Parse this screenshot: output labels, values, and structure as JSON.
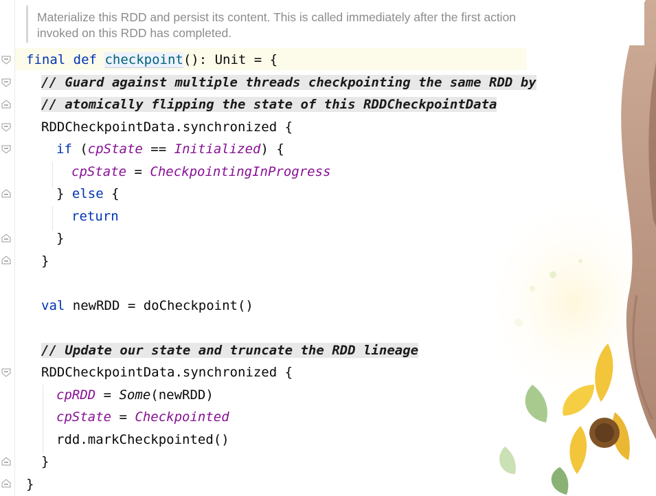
{
  "doc_comment": {
    "line1": "Materialize this RDD and persist its content. This is called immediately after the first action",
    "line2": "invoked on this RDD has completed."
  },
  "code": {
    "l1_final": "final",
    "l1_def": "def",
    "l1_name": "checkpoint",
    "l1_rest": "(): Unit = {",
    "l2_comment": "// Guard against multiple threads checkpointing the same RDD by",
    "l3_comment": "// atomically flipping the state of this RDDCheckpointData",
    "l4_sync": "RDDCheckpointData.synchronized {",
    "l5_if": "if",
    "l5_open": " (",
    "l5_cp": "cpState",
    "l5_eq": " == ",
    "l5_init": "Initialized",
    "l5_close": ") {",
    "l6_cp": "cpState",
    "l6_eq": " = ",
    "l6_val": "CheckpointingInProgress",
    "l7_close": "} ",
    "l7_else": "else",
    "l7_open": " {",
    "l8_return": "return",
    "l9_brace": "}",
    "l10_brace": "}",
    "l11_val": "val",
    "l11_rest": " newRDD = doCheckpoint()",
    "l12_comment": "// Update our state and truncate the RDD lineage",
    "l13_sync": "RDDCheckpointData.synchronized {",
    "l14_cprdd": "cpRDD",
    "l14_eq": " = ",
    "l14_some": "Some",
    "l14_rest": "(newRDD)",
    "l15_cp": "cpState",
    "l15_eq": " = ",
    "l15_val": "Checkpointed",
    "l16_call": "rdd.markCheckpointed()",
    "l17_brace": "}",
    "l18_brace": "}"
  },
  "colors": {
    "keyword": "#0033b3",
    "function_declaration": "#00627a",
    "field": "#871094",
    "doc_comment": "#8c8c8c",
    "comment_background": "#e8e8e8",
    "caret_row": "#fdfcea"
  },
  "icons": [
    "fold-open-icon",
    "fold-close-icon"
  ]
}
